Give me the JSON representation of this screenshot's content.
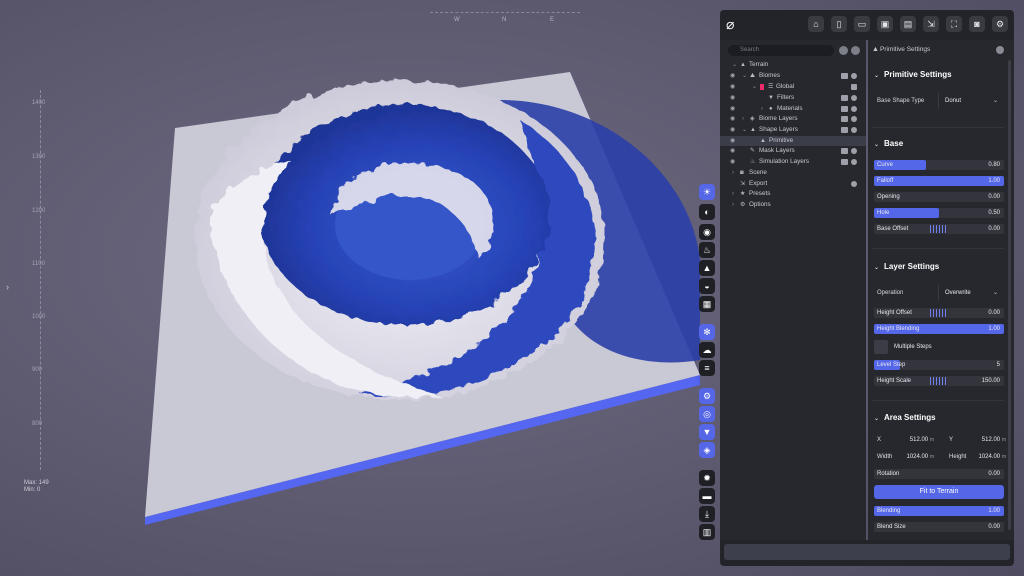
{
  "viewport": {
    "compass": [
      "W",
      "N",
      "E"
    ],
    "ruler_ticks": [
      "1400",
      "1300",
      "1200",
      "1100",
      "1000",
      "900",
      "800"
    ],
    "stats_lines": [
      "Max: 149",
      "Min: 0"
    ],
    "colors": {
      "terrain_snow": "#e8e6ef",
      "terrain_blue": "#2a47b8",
      "base_plane": "#c9c8d5",
      "plane_edge": "#5566f0"
    }
  },
  "toolbar": {
    "icons": [
      "home-icon",
      "new-file-icon",
      "open-folder-icon",
      "save-icon",
      "save-as-icon",
      "export-icon",
      "fullscreen-icon",
      "camera-icon",
      "settings-icon"
    ]
  },
  "side_tools": [
    "sun-icon",
    "moon-icon",
    "globe-icon",
    "fire-icon",
    "mountain-icon",
    "sunset-icon",
    "grid-icon",
    "snowflake-icon",
    "cloud-icon",
    "menu-icon",
    "wireframe-icon",
    "eye-icon",
    "filter-icon",
    "layers-icon",
    "gear-icon",
    "folder-icon",
    "download-icon",
    "chart-icon"
  ],
  "tree": {
    "search_placeholder": "Search",
    "rows": [
      {
        "label": "Terrain"
      },
      {
        "label": "Biomes"
      },
      {
        "label": "Global"
      },
      {
        "label": "Filters"
      },
      {
        "label": "Materials"
      },
      {
        "label": "Biome Layers"
      },
      {
        "label": "Shape Layers"
      },
      {
        "label": "Primitive"
      },
      {
        "label": "Mask Layers"
      },
      {
        "label": "Simulation Layers"
      },
      {
        "label": "Scene"
      },
      {
        "label": "Export"
      },
      {
        "label": "Presets"
      },
      {
        "label": "Options"
      }
    ]
  },
  "settings": {
    "header": "Primitive Settings",
    "primitive": {
      "title": "Primitive Settings",
      "base_shape_label": "Base Shape Type",
      "base_shape_value": "Donut"
    },
    "base": {
      "title": "Base",
      "sliders": [
        {
          "label": "Curve",
          "value": "0.80",
          "fill": 0.4
        },
        {
          "label": "Falloff",
          "value": "1.00",
          "fill": 1.0
        },
        {
          "label": "Opening",
          "value": "0.00",
          "fill": 0.0
        },
        {
          "label": "Hole",
          "value": "0.50",
          "fill": 0.5
        },
        {
          "label": "Base Offset",
          "value": "0.00",
          "fill": 0.0
        }
      ]
    },
    "layer": {
      "title": "Layer Settings",
      "operation_label": "Operation",
      "operation_value": "Overwrite",
      "sliders": [
        {
          "label": "Height Offset",
          "value": "0.00",
          "fill": 0.0
        },
        {
          "label": "Height Blending",
          "value": "1.00",
          "fill": 1.0
        }
      ],
      "multiple_steps_label": "Multiple Steps",
      "sliders2": [
        {
          "label": "Level Step",
          "value": "5",
          "fill": 0.2
        },
        {
          "label": "Height Scale",
          "value": "150.00",
          "fill": 0.0
        }
      ]
    },
    "area": {
      "title": "Area Settings",
      "x_label": "X",
      "x_value": "512.00",
      "x_unit": "m",
      "y_label": "Y",
      "y_value": "512.00",
      "y_unit": "m",
      "width_label": "Width",
      "width_value": "1024.00",
      "width_unit": "m",
      "height_label": "Height",
      "height_value": "1024.00",
      "height_unit": "m",
      "rotation_label": "Rotation",
      "rotation_value": "0.00",
      "rotation_fill": 0.0,
      "fit_button": "Fit to Terrain",
      "blending_label": "Blending",
      "blending_value": "1.00",
      "blending_fill": 1.0,
      "blend_size_label": "Blend Size",
      "blend_size_value": "0.00",
      "blend_size_fill": 0.0
    }
  }
}
